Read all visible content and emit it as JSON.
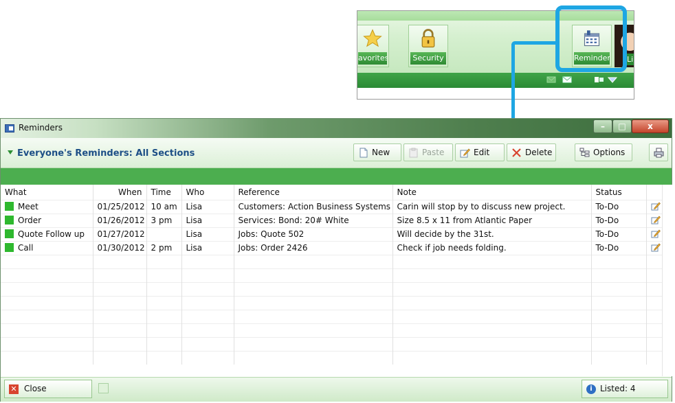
{
  "inset": {
    "tiles": [
      {
        "label": "avorites",
        "icon": "star-icon"
      },
      {
        "label": "Security",
        "icon": "lock-icon"
      },
      {
        "label": "Reminder",
        "icon": "calendar-icon"
      },
      {
        "label": "Li",
        "icon": "photo"
      }
    ],
    "callout_color": "#1ea6e3"
  },
  "window": {
    "title": "Reminders",
    "controls": {
      "minimize": "–",
      "maximize": "□",
      "close": "x"
    }
  },
  "toolbar": {
    "section_title": "Everyone's Reminders: All Sections",
    "new_label": "New",
    "paste_label": "Paste",
    "edit_label": "Edit",
    "delete_label": "Delete",
    "options_label": "Options"
  },
  "table": {
    "headers": {
      "what": "What",
      "when": "When",
      "time": "Time",
      "who": "Who",
      "reference": "Reference",
      "note": "Note",
      "status": "Status"
    },
    "rows": [
      {
        "what": "Meet",
        "when": "01/25/2012",
        "time": "10 am",
        "who": "Lisa",
        "reference": "Customers: Action Business Systems",
        "note": "Carin will stop by to discuss new project.",
        "status": "To-Do"
      },
      {
        "what": "Order",
        "when": "01/26/2012",
        "time": "3 pm",
        "who": "Lisa",
        "reference": "Services: Bond: 20# White",
        "note": "Size 8.5 x 11 from Atlantic Paper",
        "status": "To-Do"
      },
      {
        "what": "Quote Follow up",
        "when": "01/27/2012",
        "time": "",
        "who": "Lisa",
        "reference": "Jobs: Quote 502",
        "note": "Will decide by the 31st.",
        "status": "To-Do"
      },
      {
        "what": "Call",
        "when": "01/30/2012",
        "time": "2 pm",
        "who": "Lisa",
        "reference": "Jobs: Order 2426",
        "note": "Check if job needs folding.",
        "status": "To-Do"
      }
    ]
  },
  "footer": {
    "close_label": "Close",
    "listed_label": "Listed: 4"
  },
  "colors": {
    "accent_green": "#4cae4f",
    "status_square": "#2eb82e",
    "section_title": "#1d4f86"
  }
}
